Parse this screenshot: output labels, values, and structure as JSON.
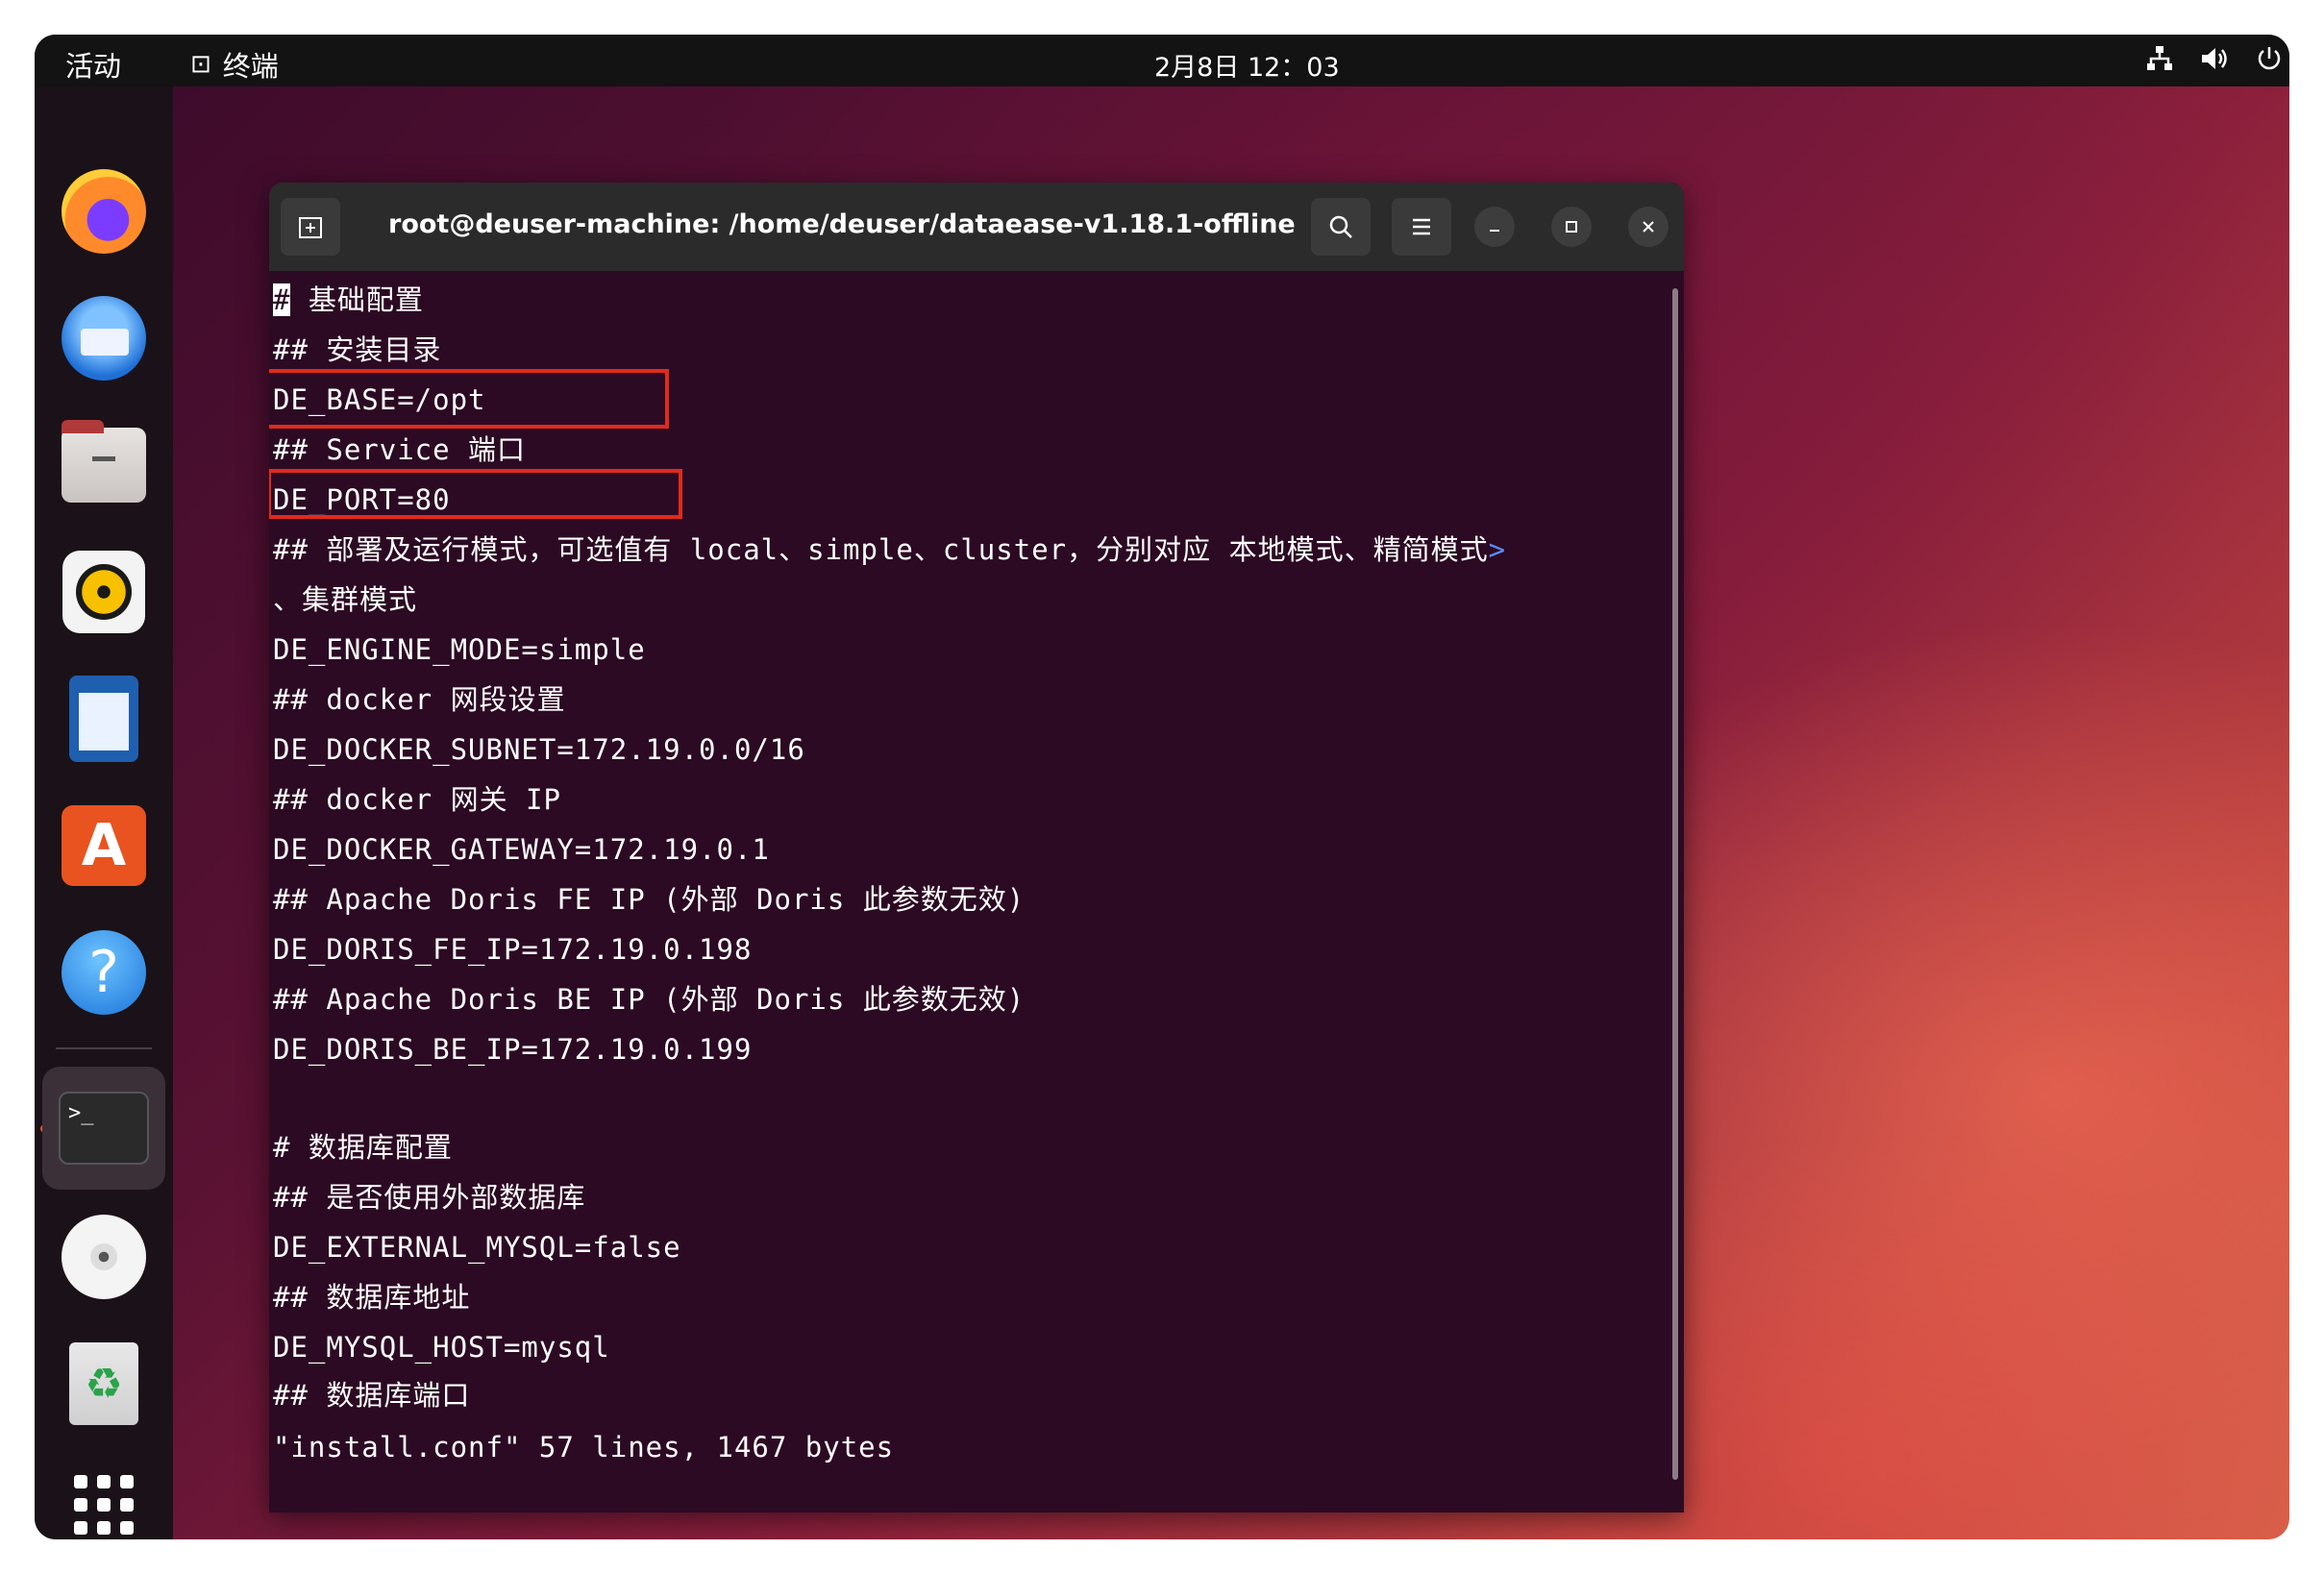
{
  "topbar": {
    "activities": "活动",
    "app_name": "终端",
    "clock": "2月8日  12：03",
    "tray_icons": [
      "network-icon",
      "volume-icon",
      "power-icon"
    ]
  },
  "dock": {
    "items": [
      "firefox-icon",
      "thunderbird-icon",
      "files-icon",
      "rhythmbox-icon",
      "libreoffice-writer-icon",
      "app-center-icon",
      "help-icon",
      "terminal-icon",
      "disc-icon",
      "trash-icon",
      "show-apps-icon"
    ],
    "active_item": "terminal-icon",
    "terminal_prompt_glyph": ">_"
  },
  "terminal": {
    "title": "root@deuser-machine: /home/deuser/dataease-v1.18.1-offline",
    "lines": [
      "# 基础配置",
      "## 安装目录",
      "DE_BASE=/opt",
      "## Service 端口",
      "DE_PORT=80",
      "## 部署及运行模式，可选值有 local、simple、cluster，分别对应 本地模式、精简模式",
      "、集群模式",
      "DE_ENGINE_MODE=simple",
      "## docker 网段设置",
      "DE_DOCKER_SUBNET=172.19.0.0/16",
      "## docker 网关 IP",
      "DE_DOCKER_GATEWAY=172.19.0.1",
      "## Apache Doris FE IP (外部 Doris 此参数无效)",
      "DE_DORIS_FE_IP=172.19.0.198",
      "## Apache Doris BE IP (外部 Doris 此参数无效)",
      "DE_DORIS_BE_IP=172.19.0.199",
      "",
      "# 数据库配置",
      "## 是否使用外部数据库",
      "DE_EXTERNAL_MYSQL=false",
      "## 数据库地址",
      "DE_MYSQL_HOST=mysql",
      "## 数据库端口"
    ],
    "wrap_marker": ">",
    "status_line": "\"install.conf\" 57 lines, 1467 bytes",
    "highlight_color": "#e02a1d"
  },
  "colors": {
    "terminal_bg": "#2c0a23",
    "topbar_bg": "#131313",
    "accent": "#e95420"
  }
}
